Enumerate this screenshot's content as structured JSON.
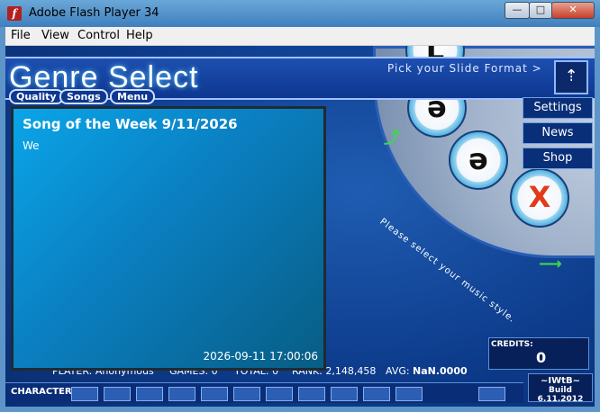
{
  "window": {
    "app_icon": "flash-icon",
    "title": "Adobe Flash Player 34",
    "minimize": "—",
    "maximize": "□",
    "close": "✕"
  },
  "menu": [
    "File",
    "View",
    "Control",
    "Help"
  ],
  "header": {
    "title": "Genre Select",
    "pick_text": "Pick your Slide Format >",
    "pick_icon": "slide-format-icon"
  },
  "tabs": [
    "Quality",
    "Songs",
    "Menu"
  ],
  "side_buttons": [
    "Settings",
    "News",
    "Shop"
  ],
  "wheel": {
    "hint": "Please select your music style.",
    "discs": [
      "L",
      "ə",
      "ə",
      "X"
    ]
  },
  "song_of_week": {
    "title": "Song of the Week 9/11/2026",
    "body": "We",
    "timestamp": "2026-09-11 17:00:06"
  },
  "stats": {
    "player": "PLAYER: Anonymous",
    "games": "GAMES: 0",
    "total": "TOTAL: 0",
    "rank": "RANK: 2,148,458",
    "avg_label": "AVG:",
    "avg_value": "NaN.0000"
  },
  "credits": {
    "label": "CREDITS:",
    "value": "0"
  },
  "build": {
    "tag": "~IWtB~",
    "text": "Build 6.11.2012"
  },
  "character": {
    "label": "CHARACTER",
    "slots": 12
  },
  "colors": {
    "accent": "#0e3790",
    "panel": "#0a8fd0",
    "highlight": "#3fd84c"
  }
}
